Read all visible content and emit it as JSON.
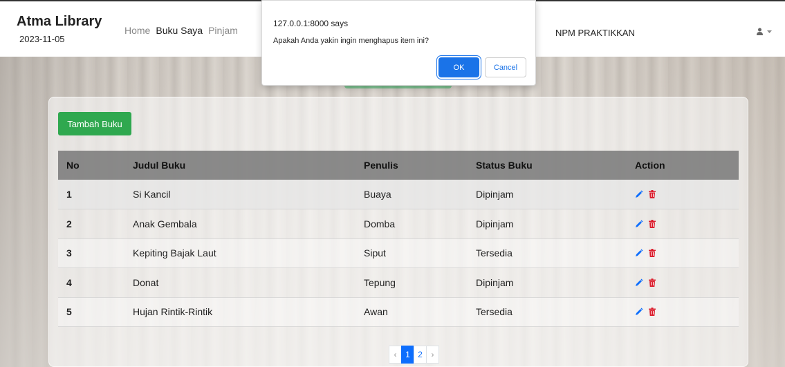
{
  "navbar": {
    "brand": "Atma Library",
    "date": "2023-11-05",
    "links": [
      {
        "label": "Home"
      },
      {
        "label": "Buku Saya"
      },
      {
        "label": "Pinjam"
      }
    ],
    "npm": "NPM PRAKTIKKAN",
    "user_icon": "user-icon",
    "caret_icon": "caret-down-icon"
  },
  "add_button": "Tambah Buku",
  "table": {
    "headers": [
      "No",
      "Judul Buku",
      "Penulis",
      "Status Buku",
      "Action"
    ],
    "rows": [
      {
        "no": "1",
        "judul": "Si Kancil",
        "penulis": "Buaya",
        "status": "Dipinjam"
      },
      {
        "no": "2",
        "judul": "Anak Gembala",
        "penulis": "Domba",
        "status": "Dipinjam"
      },
      {
        "no": "3",
        "judul": "Kepiting Bajak Laut",
        "penulis": "Siput",
        "status": "Tersedia"
      },
      {
        "no": "4",
        "judul": "Donat",
        "penulis": "Tepung",
        "status": "Dipinjam"
      },
      {
        "no": "5",
        "judul": "Hujan Rintik-Rintik",
        "penulis": "Awan",
        "status": "Tersedia"
      }
    ]
  },
  "pagination": {
    "prev": "‹",
    "pages": [
      "1",
      "2"
    ],
    "next": "›",
    "active": "1"
  },
  "dialog": {
    "title": "127.0.0.1:8000 says",
    "message": "Apakah Anda yakin ingin menghapus item ini?",
    "ok": "OK",
    "cancel": "Cancel"
  },
  "colors": {
    "accent_green": "#2fa84f",
    "primary_blue": "#0d6efd",
    "delete_red": "#dc1f2e"
  }
}
